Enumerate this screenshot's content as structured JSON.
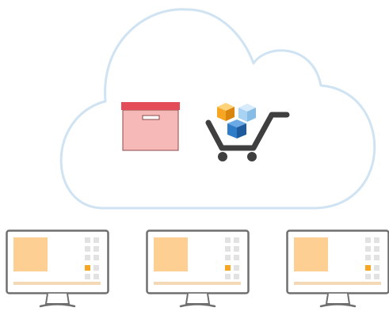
{
  "colors": {
    "cloud_stroke": "#cfe3f3",
    "box_fill": "#f7b8b8",
    "box_lid": "#e34d57",
    "cart_body": "#3f3f3f",
    "cube_orange": "#f6a623",
    "cube_light_blue": "#a9d3f2",
    "cube_blue": "#2f7cc9",
    "monitor_frame": "#6f6f6f",
    "monitor_panel": "#fdcf92",
    "monitor_tile": "#e2e2e2",
    "monitor_tile_accent": "#f6a623",
    "monitor_baseline": "#f4d9b6"
  },
  "cloud": {
    "icon": "cloud-outline"
  },
  "storage": {
    "icon": "archive-box-icon"
  },
  "cart": {
    "icon": "shopping-cart-icon",
    "cubes": [
      "orange-cube",
      "light-blue-cube",
      "blue-cube"
    ]
  },
  "clients": [
    {
      "icon": "desktop-monitor-icon"
    },
    {
      "icon": "desktop-monitor-icon"
    },
    {
      "icon": "desktop-monitor-icon"
    }
  ]
}
